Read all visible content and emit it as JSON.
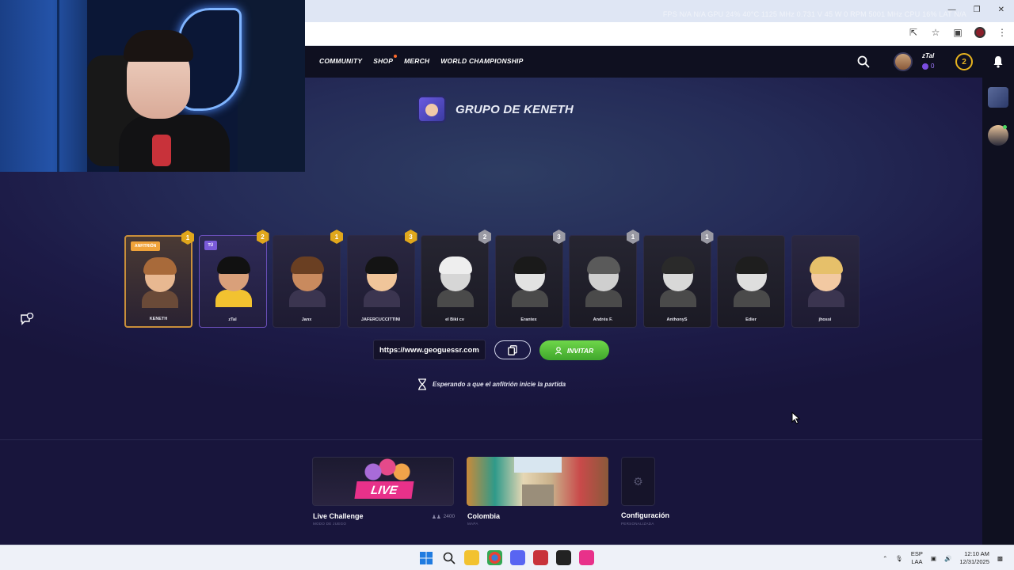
{
  "overlay": {
    "stats": "FPS N/A N/A  GPU 24% 40°C 1125 MHz 0.731 V 45 W 0 RPM 5001 MHz  CPU 16%  LAT N/A"
  },
  "nav": {
    "items": [
      "COMMUNITY",
      "SHOP",
      "MERCH",
      "WORLD CHAMPIONSHIP"
    ]
  },
  "user": {
    "name": "zTal",
    "coins": "0",
    "level": "2"
  },
  "group": {
    "title": "GRUPO DE KENETH"
  },
  "players": [
    {
      "name": "KENETH",
      "level": "1",
      "badge": "ANFITRIÓN",
      "role": "host",
      "medal": "gold",
      "skin": "#e8b891",
      "hair": "#a86a3a",
      "torso": "#6a4a38"
    },
    {
      "name": "zTal",
      "level": "2",
      "badge": "TÚ",
      "role": "you",
      "medal": "gold",
      "skin": "#d9a07a",
      "hair": "#111111",
      "torso": "#f2c230"
    },
    {
      "name": "Janx",
      "level": "1",
      "badge": "",
      "role": "",
      "medal": "gold",
      "skin": "#c98a5e",
      "hair": "#6a3f22",
      "torso": "#3b3550"
    },
    {
      "name": "JAFERCUCCITTINI",
      "level": "3",
      "badge": "",
      "role": "",
      "medal": "gold",
      "skin": "#f0c59a",
      "hair": "#141414",
      "torso": "#3b3550"
    },
    {
      "name": "el Biki cv",
      "level": "2",
      "badge": "",
      "role": "gray",
      "medal": "silver",
      "skin": "#d6d6d6",
      "hair": "#eeeeee",
      "torso": "#4a4a4a"
    },
    {
      "name": "Erantex",
      "level": "3",
      "badge": "",
      "role": "gray",
      "medal": "silver",
      "skin": "#e2e2e2",
      "hair": "#1a1a1a",
      "torso": "#4a4a4a"
    },
    {
      "name": "Andrés F.",
      "level": "1",
      "badge": "",
      "role": "gray",
      "medal": "silver",
      "skin": "#cfcfcf",
      "hair": "#5a5a5a",
      "torso": "#4a4a4a"
    },
    {
      "name": "AnthonyS",
      "level": "1",
      "badge": "",
      "role": "gray",
      "medal": "silver",
      "skin": "#d8d8d8",
      "hair": "#2a2a2a",
      "torso": "#4a4a4a"
    },
    {
      "name": "Edier",
      "level": "",
      "badge": "",
      "role": "gray",
      "medal": "",
      "skin": "#dedede",
      "hair": "#1e1e1e",
      "torso": "#4a4a4a"
    },
    {
      "name": "jhossi",
      "level": "",
      "badge": "",
      "role": "",
      "medal": "",
      "skin": "#f2c9a2",
      "hair": "#e6c06a",
      "torso": "#3b3550"
    }
  ],
  "invite": {
    "url": "https://www.geoguessr.com/",
    "button": "INVITAR",
    "waiting": "Esperando a que el anfitrión inicie la partida"
  },
  "tiles": {
    "live": {
      "badge": "LIVE",
      "title": "Live Challenge",
      "subtitle": "MODO DE JUEGO",
      "players": "2400"
    },
    "map": {
      "title": "Colombia",
      "subtitle": "MAPA"
    },
    "config": {
      "title": "Configuración",
      "subtitle": "PERSONALIZADA"
    }
  },
  "taskbar": {
    "lang1": "ESP",
    "lang2": "LAA",
    "time": "12:10 AM",
    "date": "12/31/2025"
  },
  "colors": {
    "accent_green": "#4cbe36",
    "gold": "#e0a71c",
    "host": "#f0a33a",
    "you": "#7a5ad8",
    "live": "#e8318a"
  }
}
